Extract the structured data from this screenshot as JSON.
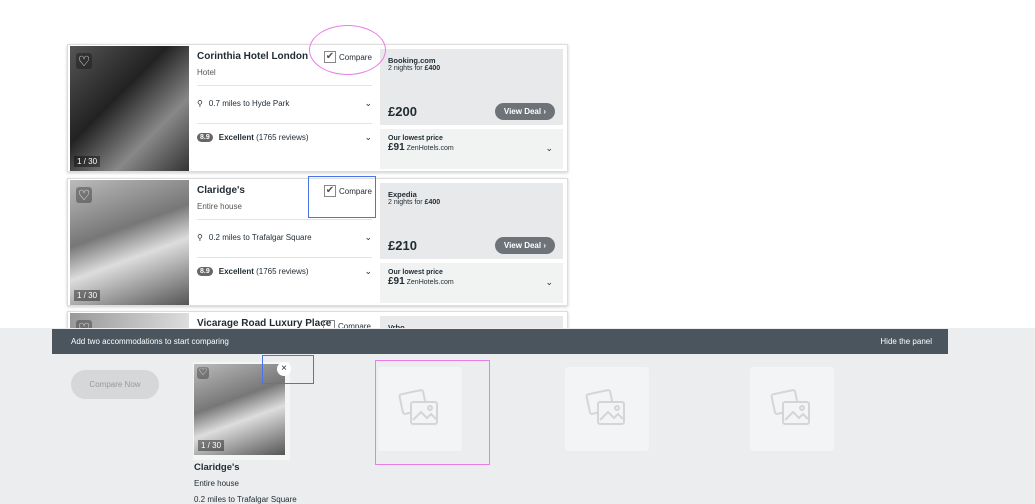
{
  "listings": [
    {
      "name": "Corinthia Hotel London",
      "type": "Hotel",
      "photo_count": "1 / 30",
      "compare_label": "Compare",
      "compare_checked": true,
      "distance": "0.7 miles to Hyde Park",
      "score": "8.9",
      "rating": "Excellent",
      "reviews": "(1765 reviews)",
      "provider": "Booking.com",
      "nights_text": "2 nights for ",
      "nights_price": "£400",
      "price": "£200",
      "view_deal": "View Deal",
      "lowest_label": "Our lowest price",
      "lowest_price": "£91",
      "lowest_provider": "ZenHotels.com"
    },
    {
      "name": "Claridge's",
      "type": "Entire house",
      "photo_count": "1 / 30",
      "compare_label": "Compare",
      "compare_checked": true,
      "distance": "0.2 miles to Trafalgar Square",
      "score": "8.9",
      "rating": "Excellent",
      "reviews": "(1765 reviews)",
      "provider": "Expedia",
      "nights_text": "2 nights for ",
      "nights_price": "£400",
      "price": "£210",
      "view_deal": "View Deal",
      "lowest_label": "Our lowest price",
      "lowest_price": "£91",
      "lowest_provider": "ZenHotels.com"
    },
    {
      "name": "Vicarage Road Luxury Place",
      "compare_label": "Compare",
      "compare_checked": false,
      "provider": "Vrbo"
    }
  ],
  "compare_panel": {
    "message": "Add two accommodations to start comparing",
    "hide_label": "Hide the panel",
    "compare_now": "Compare Now",
    "selected": {
      "name": "Claridge's",
      "type": "Entire house",
      "distance": "0.2 miles to Trafalgar Square",
      "photo_count": "1 / 30"
    },
    "empty_slots": 3
  }
}
